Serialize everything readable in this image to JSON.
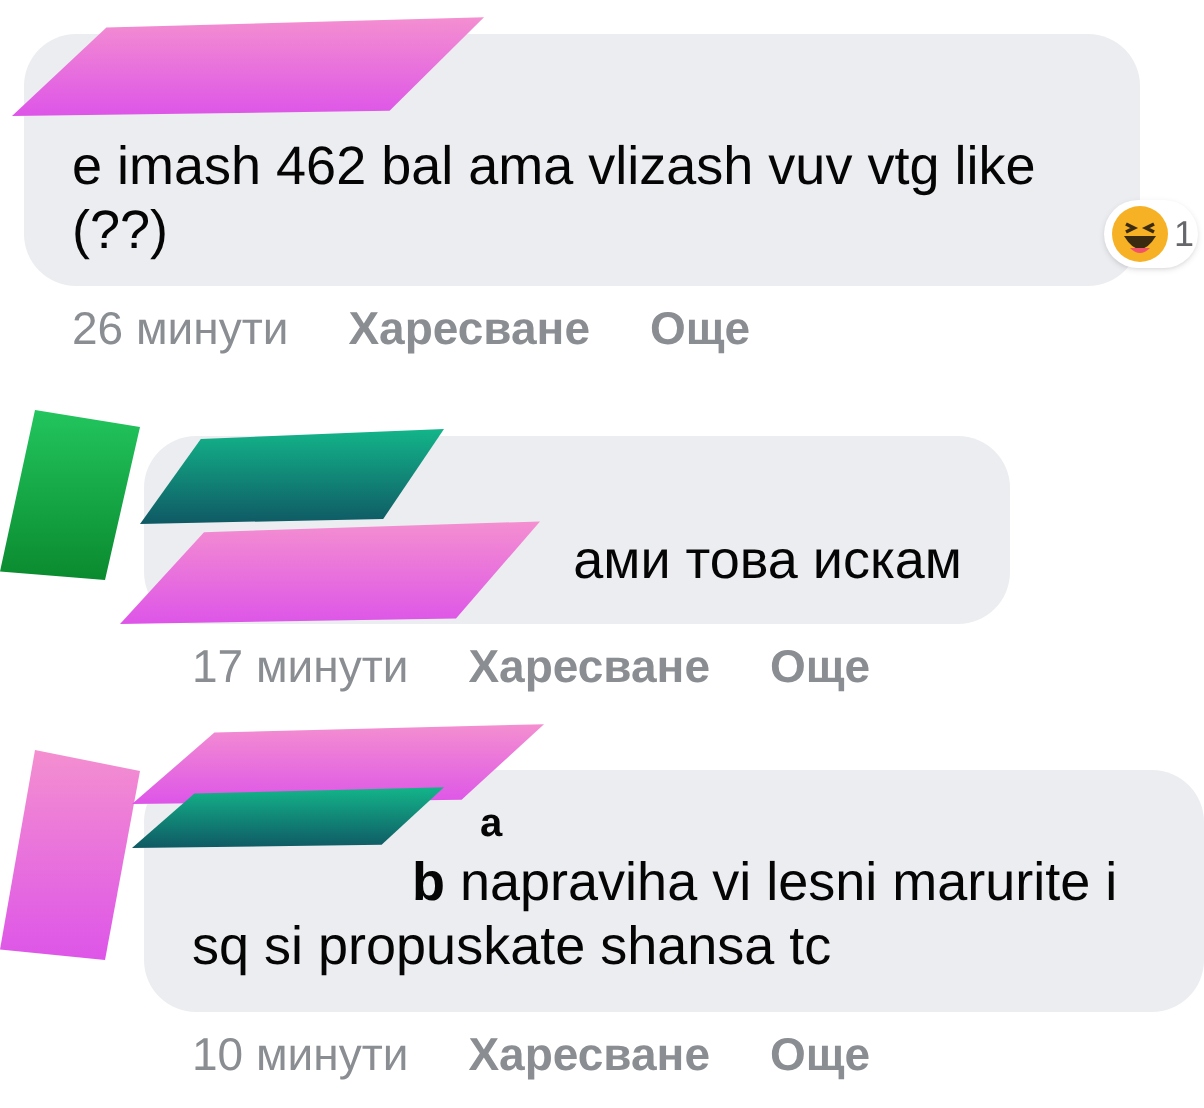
{
  "comments": [
    {
      "body": "e imash 462 bal ama vlizash vuv vtg like (??)",
      "reaction_count": "1",
      "time": "26 минути",
      "actions": [
        "Харесване",
        "Още"
      ]
    },
    {
      "body": "ами това искам",
      "time": "17 минути",
      "actions": [
        "Харесване",
        "Още"
      ]
    },
    {
      "author": "a",
      "body": "**b** napraviha vi lesni marurite i sq si propuskate shansa tc",
      "time": "10 минути",
      "actions": [
        "Харесване",
        "Още"
      ]
    }
  ]
}
